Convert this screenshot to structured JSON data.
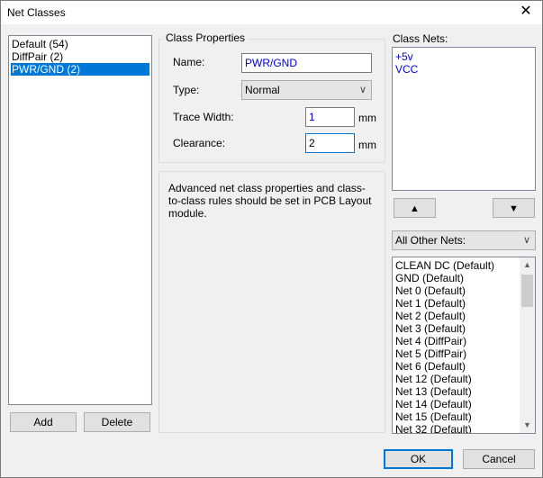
{
  "window": {
    "title": "Net Classes",
    "close_glyph": "✕"
  },
  "classes": {
    "items": [
      {
        "label": "Default (54)"
      },
      {
        "label": "DiffPair (2)"
      },
      {
        "label": "PWR/GND (2)"
      }
    ],
    "selected_index": 2,
    "add_label": "Add",
    "delete_label": "Delete"
  },
  "properties": {
    "group_label": "Class Properties",
    "name_label": "Name:",
    "name_value": "PWR/GND",
    "type_label": "Type:",
    "type_value": "Normal",
    "trace_width_label": "Trace Width:",
    "trace_width_value": "1",
    "trace_width_unit": "mm",
    "clearance_label": "Clearance:",
    "clearance_value": "2",
    "clearance_unit": "mm"
  },
  "info": {
    "line1": "Advanced net class properties and class-",
    "line2": "to-class rules should be set in PCB Layout",
    "line3": "module."
  },
  "class_nets": {
    "label": "Class Nets:",
    "items": [
      "+5v",
      "VCC"
    ],
    "up_icon": "▲",
    "down_icon": "▼"
  },
  "other_nets": {
    "filter_value": "All Other Nets:",
    "items": [
      "CLEAN DC (Default)",
      "GND (Default)",
      "Net 0 (Default)",
      "Net 1 (Default)",
      "Net 2 (Default)",
      "Net 3 (Default)",
      "Net 4 (DiffPair)",
      "Net 5 (DiffPair)",
      "Net 6 (Default)",
      "Net 12 (Default)",
      "Net 13 (Default)",
      "Net 14 (Default)",
      "Net 15 (Default)",
      "Net 32 (Default)"
    ]
  },
  "footer": {
    "ok_label": "OK",
    "cancel_label": "Cancel"
  },
  "colors": {
    "selection": "#0078d7",
    "net_text": "#0000cc"
  }
}
